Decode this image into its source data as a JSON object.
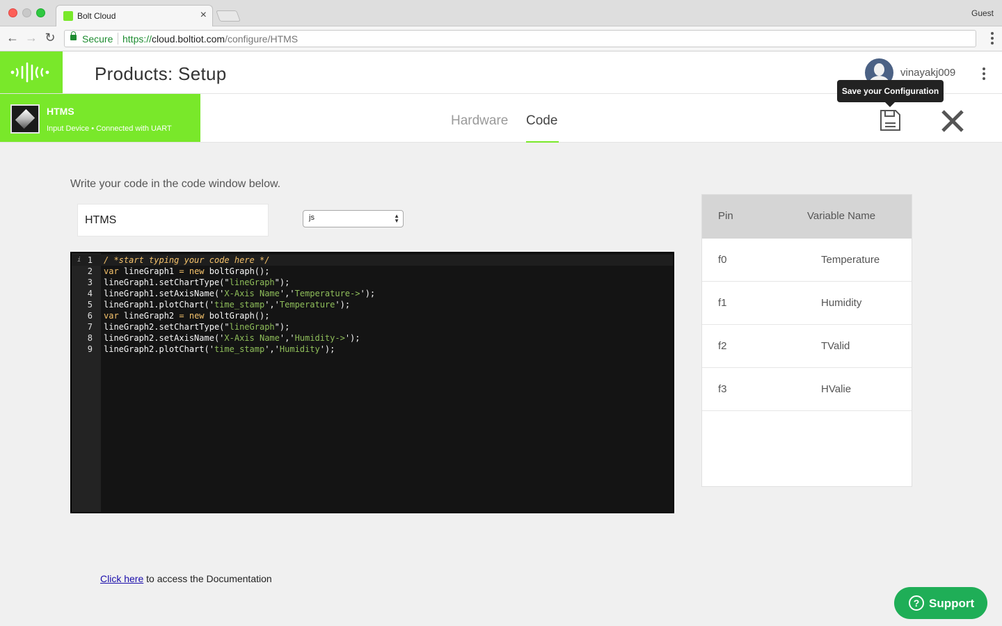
{
  "browser": {
    "tab_title": "Bolt Cloud",
    "tab_close": "×",
    "profile": "Guest",
    "secure_label": "Secure",
    "url_scheme": "https://",
    "url_host": "cloud.boltiot.com",
    "url_path": "/configure/HTMS",
    "back_glyph": "←",
    "forward_glyph": "→",
    "reload_glyph": "↻"
  },
  "header": {
    "title": "Products: Setup",
    "username": "vinayakj009",
    "brand_color": "#79e82a"
  },
  "product": {
    "name": "HTMS",
    "subtitle": "Input Device • Connected with UART"
  },
  "tabs": [
    {
      "label": "Hardware",
      "active": false
    },
    {
      "label": "Code",
      "active": true
    }
  ],
  "toolbar": {
    "save_tooltip": "Save your Configuration",
    "save_icon": "floppy-disk-icon",
    "close_icon": "close-icon"
  },
  "editor": {
    "instruction": "Write your code in the code window below.",
    "file_name": "HTMS",
    "language": "js",
    "info_marker": "i",
    "lines": [
      "/ *start typing your code here */",
      "var lineGraph1 = new boltGraph();",
      "lineGraph1.setChartType(\"lineGraph\");",
      "lineGraph1.setAxisName('X-Axis Name','Temperature->');",
      "lineGraph1.plotChart('time_stamp','Temperature');",
      "var lineGraph2 = new boltGraph();",
      "lineGraph2.setChartType(\"lineGraph\");",
      "lineGraph2.setAxisName('X-Axis Name','Humidity->');",
      "lineGraph2.plotChart('time_stamp','Humidity');"
    ]
  },
  "pins": {
    "headers": [
      "Pin",
      "Variable Name"
    ],
    "rows": [
      {
        "pin": "f0",
        "variable": "Temperature"
      },
      {
        "pin": "f1",
        "variable": "Humidity"
      },
      {
        "pin": "f2",
        "variable": "TValid"
      },
      {
        "pin": "f3",
        "variable": "HValie"
      }
    ]
  },
  "docs": {
    "link_text": "Click here",
    "text": " to access the Documentation"
  },
  "support": {
    "label": "Support",
    "icon_glyph": "?",
    "color": "#1fae57"
  }
}
